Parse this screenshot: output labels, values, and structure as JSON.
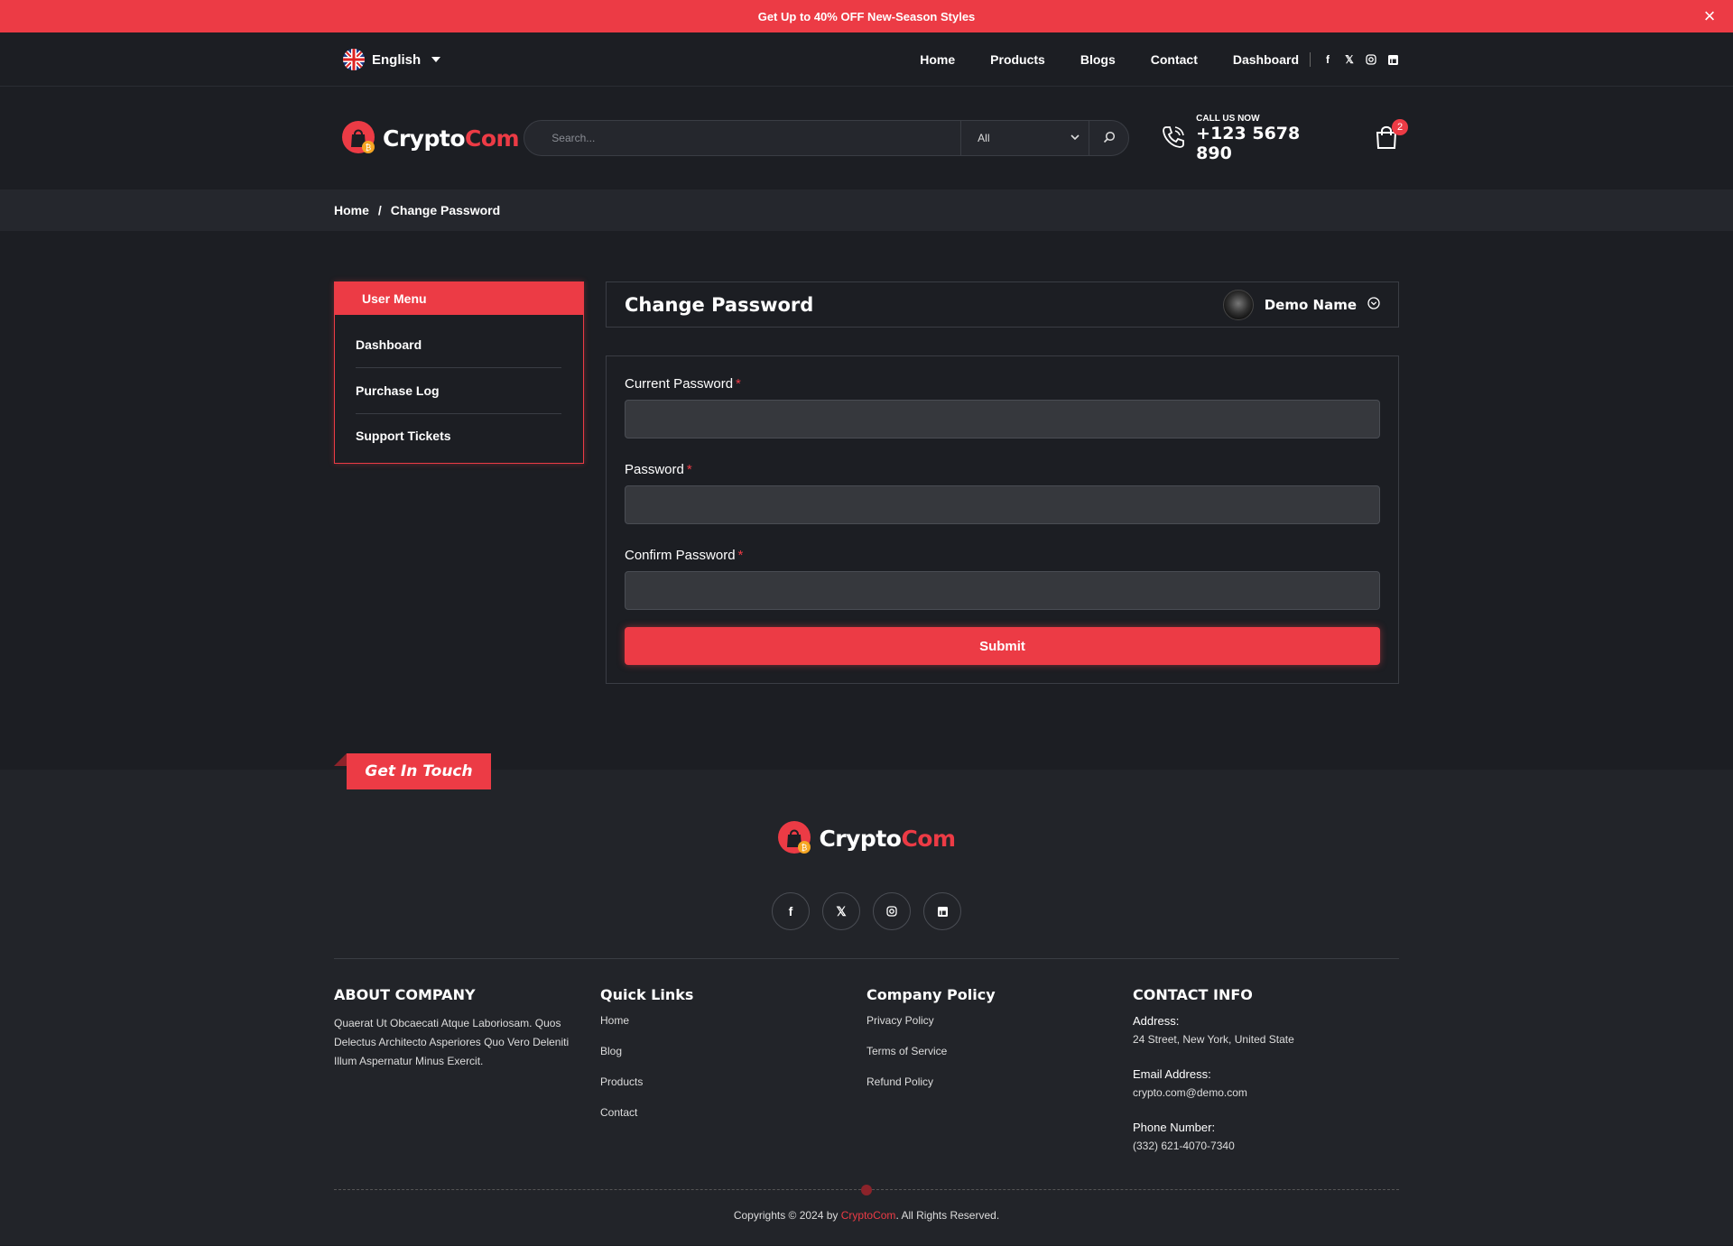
{
  "announcement": {
    "text": "Get Up to 40% OFF New-Season Styles"
  },
  "lang": {
    "label": "English"
  },
  "nav": {
    "items": [
      "Home",
      "Products",
      "Blogs",
      "Contact",
      "Dashboard"
    ]
  },
  "brand": {
    "name_main": "Crypto",
    "name_accent": "Com"
  },
  "search": {
    "placeholder": "Search...",
    "category": "All"
  },
  "call": {
    "label": "CALL US NOW",
    "number": "+123 5678 890"
  },
  "cart": {
    "count": "2"
  },
  "breadcrumb": {
    "home": "Home",
    "sep": "/",
    "current": "Change Password"
  },
  "user_menu": {
    "title": "User Menu",
    "items": [
      "Dashboard",
      "Purchase Log",
      "Support Tickets"
    ]
  },
  "page": {
    "title": "Change Password",
    "user_name": "Demo Name"
  },
  "form": {
    "current_password_label": "Current Password",
    "password_label": "Password",
    "confirm_password_label": "Confirm Password",
    "required_mark": "*",
    "submit_label": "Submit"
  },
  "footer": {
    "tag": "Get In Touch",
    "about": {
      "title": "ABOUT COMPANY",
      "text": "Quaerat Ut Obcaecati Atque Laboriosam. Quos Delectus Architecto Asperiores Quo Vero Deleniti Illum Aspernatur Minus Exercit."
    },
    "quick_links": {
      "title": "Quick Links",
      "items": [
        "Home",
        "Blog",
        "Products",
        "Contact"
      ]
    },
    "policy": {
      "title": "Company Policy",
      "items": [
        "Privacy Policy",
        "Terms of Service",
        "Refund Policy"
      ]
    },
    "contact": {
      "title": "CONTACT INFO",
      "address_label": "Address:",
      "address": "24 Street, New York, United State",
      "email_label": "Email Address:",
      "email": "crypto.com@demo.com",
      "phone_label": "Phone Number:",
      "phone": "(332) 621-4070-7340"
    },
    "copyright_pre": "Copyrights © 2024 by ",
    "copyright_brand": "CryptoCom",
    "copyright_post": ". All Rights Reserved."
  },
  "colors": {
    "accent": "#ec3b45",
    "background": "#1c1e23",
    "panel": "#25272d"
  },
  "icons": [
    "close-icon",
    "uk-flag-icon",
    "facebook-icon",
    "x-icon",
    "instagram-icon",
    "linkedin-icon",
    "search-icon",
    "phone-icon",
    "cart-icon",
    "chevron-down-icon"
  ]
}
